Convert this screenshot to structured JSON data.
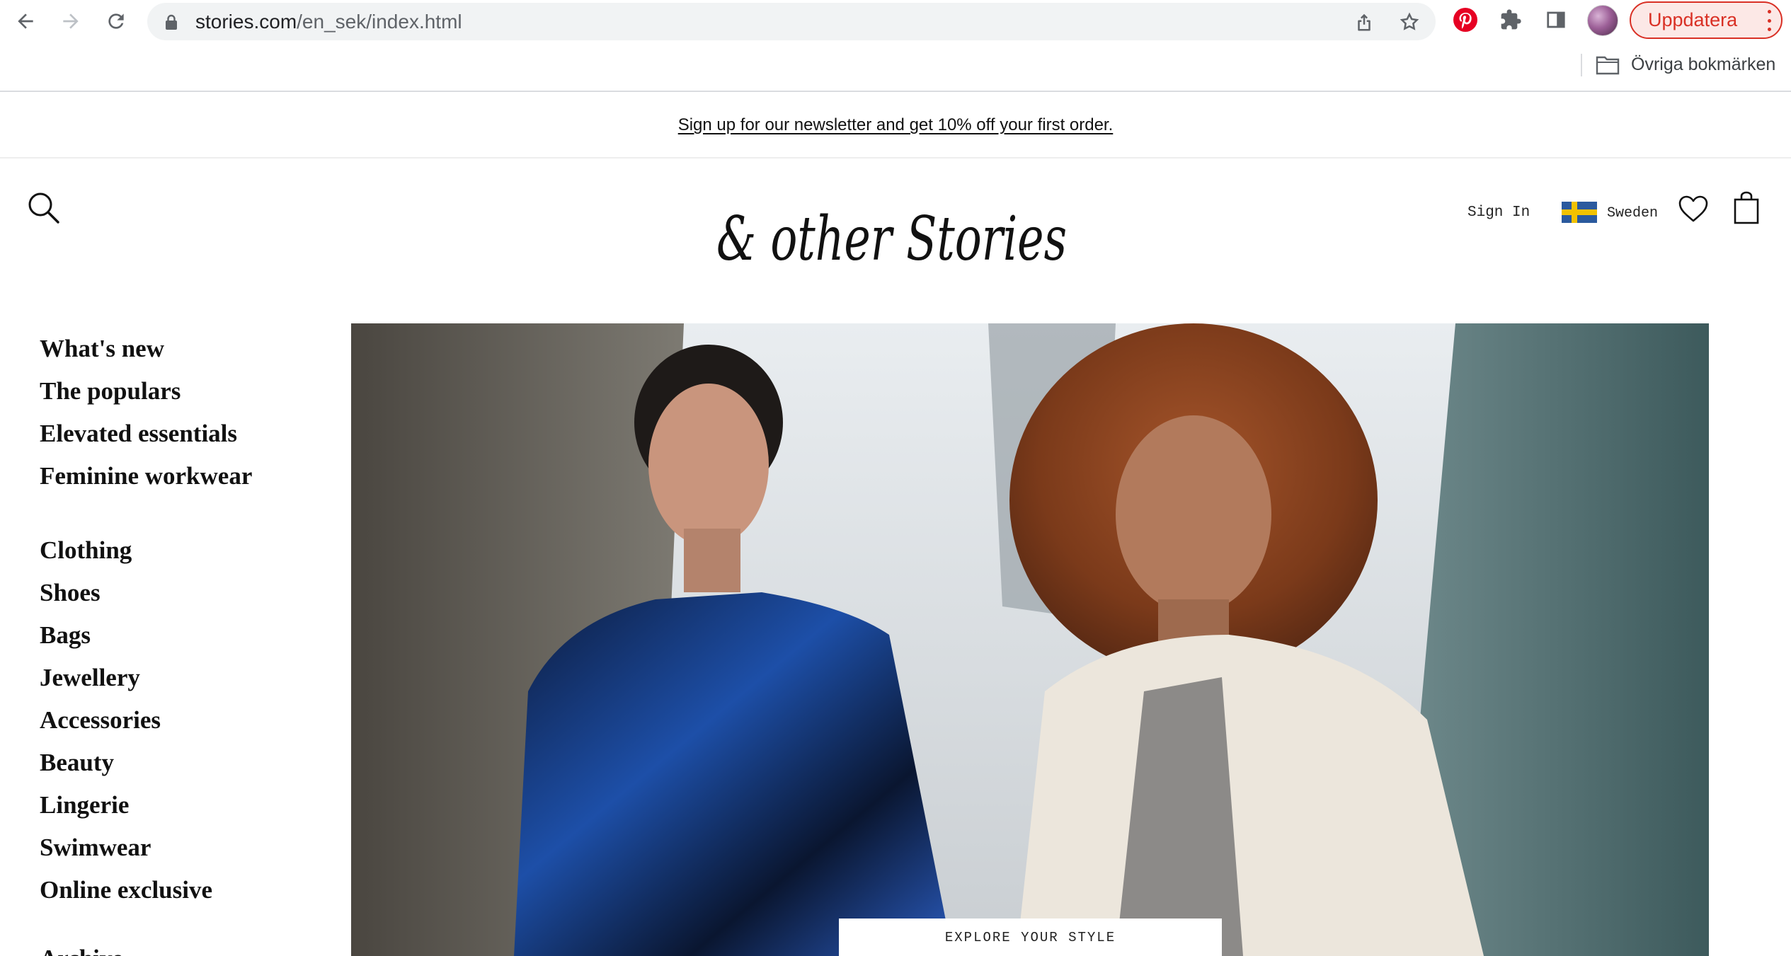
{
  "browser": {
    "url_domain": "stories.com",
    "url_path": "/en_sek/index.html",
    "update_label": "Uppdatera",
    "bookmarks_folder_label": "Övriga bokmärken",
    "icons": [
      "back-icon",
      "forward-icon",
      "reload-icon",
      "lock-icon",
      "share-icon",
      "star-icon",
      "pinterest-icon",
      "extensions-icon",
      "side-panel-icon",
      "profile-avatar",
      "menu-dots-icon",
      "folder-icon"
    ],
    "colors": {
      "update_accent": "#d93025",
      "pinterest": "#e60023",
      "omnibox_bg": "#f1f3f4"
    }
  },
  "site": {
    "promo_text": "Sign up for our newsletter and get 10% off your first order.",
    "logo_text": "& other Stories",
    "header": {
      "sign_in_label": "Sign In",
      "country_label": "Sweden",
      "icons": [
        "search-icon",
        "sweden-flag",
        "heart-icon",
        "bag-icon"
      ]
    },
    "nav_group_1": [
      "What's new",
      "The populars",
      "Elevated essentials",
      "Feminine workwear"
    ],
    "nav_group_2": [
      "Clothing",
      "Shoes",
      "Bags",
      "Jewellery",
      "Accessories",
      "Beauty",
      "Lingerie",
      "Swimwear",
      "Online exclusive"
    ],
    "nav_partial": "Archive",
    "hero": {
      "cta_label": "EXPLORE YOUR STYLE"
    }
  }
}
